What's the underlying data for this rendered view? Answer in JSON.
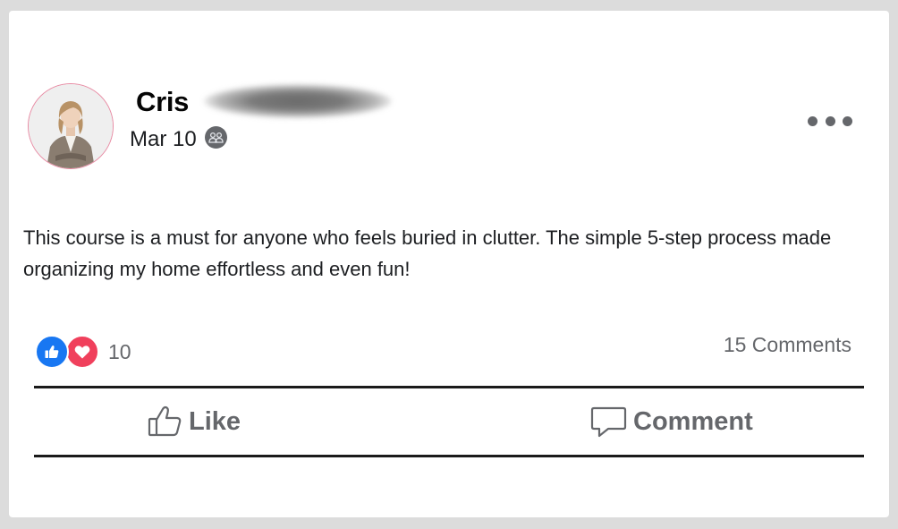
{
  "post": {
    "author": {
      "name": "Cris"
    },
    "date": "Mar 10",
    "audience_icon": "friends-icon",
    "text": "This course is a must for anyone who feels buried in clutter. The simple 5-step process made organizing my home effortless and even fun!",
    "reactions": {
      "types": [
        "like",
        "love"
      ],
      "count": "10"
    },
    "comments_count": "15 Comments",
    "actions": {
      "like_label": "Like",
      "comment_label": "Comment"
    }
  },
  "colors": {
    "like_blue": "#1877f2",
    "love_red": "#f0405c",
    "secondary_text": "#65676b"
  }
}
